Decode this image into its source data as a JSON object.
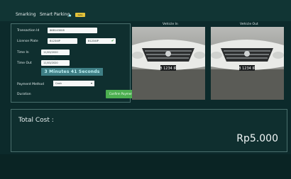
{
  "header": {
    "brand": "Smarking",
    "app_title": "Smart Parking",
    "badge_text": "beta"
  },
  "form": {
    "transaction_id": {
      "label": "Transaction Id",
      "value": "86B143008"
    },
    "license_plate": {
      "label": "License Plate",
      "value_in": "B1234IP",
      "value_out": "B1234IP"
    },
    "time_in": {
      "label": "Time In",
      "value": "11/03/2020 11:04:28"
    },
    "time_out": {
      "label": "Time Out",
      "value": "11/03/2020 11:08:08"
    },
    "duration": {
      "label": "Duration",
      "value": "3 Minutes 41 Seconds"
    },
    "payment_method": {
      "label": "Payment Method",
      "value": "Cash"
    },
    "confirm_label": "Confirm Payment"
  },
  "camera": {
    "in_label": "Vehicle In",
    "out_label": "Vehicle Out",
    "plate_text": "B 1234 IP"
  },
  "total": {
    "label": "Total Cost :",
    "value": "Rp5.000"
  }
}
